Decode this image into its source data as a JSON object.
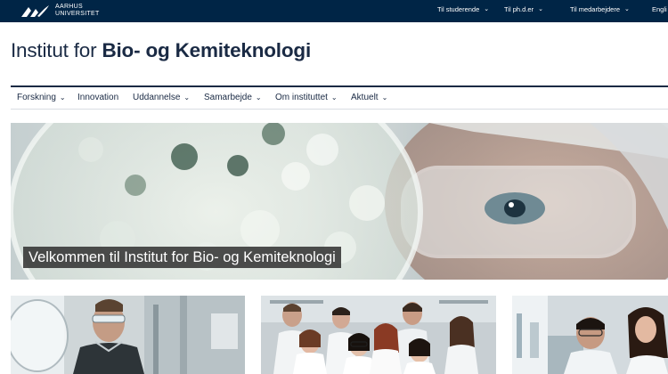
{
  "brand": {
    "logo_line1": "AARHUS",
    "logo_line2": "UNIVERSITET"
  },
  "topnav": {
    "items": [
      {
        "label": "Til studerende",
        "has_dropdown": true
      },
      {
        "label": "Til ph.d.er",
        "has_dropdown": true
      },
      {
        "label": "Til medarbejdere",
        "has_dropdown": true
      },
      {
        "label": "Engli",
        "has_dropdown": false
      }
    ],
    "dropdown_icon": "chevron-down-icon"
  },
  "site": {
    "title_prefix": "Institut for ",
    "title_bold": "Bio- og Kemiteknologi"
  },
  "mainnav": {
    "items": [
      {
        "label": "Forskning",
        "has_dropdown": true
      },
      {
        "label": "Innovation",
        "has_dropdown": false
      },
      {
        "label": "Uddannelse",
        "has_dropdown": true
      },
      {
        "label": "Samarbejde",
        "has_dropdown": true
      },
      {
        "label": "Om instituttet",
        "has_dropdown": true
      },
      {
        "label": "Aktuelt",
        "has_dropdown": true
      }
    ]
  },
  "hero": {
    "caption": "Velkommen til Institut for Bio- og Kemiteknologi",
    "image_subject": "researcher-with-safety-glasses-and-petri-dish"
  },
  "cards": [
    {
      "image_subject": "researcher-with-glass-reactor"
    },
    {
      "image_subject": "group-of-researchers-in-lab"
    },
    {
      "image_subject": "researchers-at-lab-bench"
    }
  ],
  "colors": {
    "topbar_bg": "#002546",
    "text_dark": "#1a2a44",
    "rule": "#1a2a44",
    "caption_bg": "#282828"
  }
}
